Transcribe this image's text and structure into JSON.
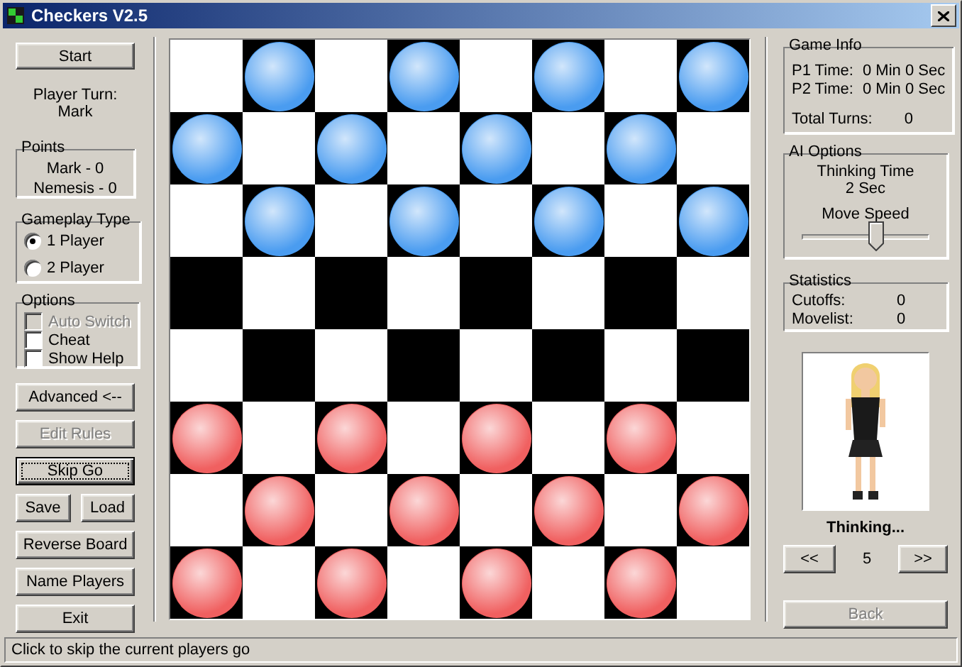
{
  "window": {
    "title": "Checkers V2.5"
  },
  "left": {
    "start_button": {
      "label": "Start",
      "disabled": false,
      "focused": false
    },
    "player_turn": {
      "label": "Player Turn:",
      "value": "Mark"
    },
    "points": {
      "title": "Points",
      "lines": [
        "Mark - 0",
        "Nemesis - 0"
      ]
    },
    "gameplay_type": {
      "title": "Gameplay Type",
      "options": [
        {
          "label": "1 Player",
          "selected": true
        },
        {
          "label": "2 Player",
          "selected": false
        }
      ]
    },
    "options": {
      "title": "Options",
      "checkboxes": [
        {
          "label": "Auto Switch",
          "checked": false,
          "disabled": true
        },
        {
          "label": "Cheat",
          "checked": false,
          "disabled": false
        },
        {
          "label": "Show Help",
          "checked": false,
          "disabled": false
        }
      ]
    },
    "button_rows": [
      [
        {
          "label": "Advanced <--",
          "disabled": false,
          "focused": false
        }
      ],
      [
        {
          "label": "Edit Rules",
          "disabled": true,
          "focused": false
        }
      ],
      [
        {
          "label": "Skip Go",
          "disabled": false,
          "focused": true
        }
      ],
      [
        {
          "label": "Save",
          "disabled": false,
          "focused": false
        },
        {
          "label": "Load",
          "disabled": false,
          "focused": false
        }
      ],
      [
        {
          "label": "Reverse Board",
          "disabled": false,
          "focused": false
        }
      ],
      [
        {
          "label": "Name Players",
          "disabled": false,
          "focused": false
        }
      ],
      [
        {
          "label": "Exit",
          "disabled": false,
          "focused": false
        }
      ]
    ]
  },
  "board": {
    "rows": [
      {
        "cells": [
          {
            "kind": "empty"
          },
          {
            "kind": "piece",
            "color": "#4a9cf0"
          },
          {
            "kind": "empty"
          },
          {
            "kind": "piece",
            "color": "#4a9cf0"
          },
          {
            "kind": "empty"
          },
          {
            "kind": "piece",
            "color": "#4a9cf0"
          },
          {
            "kind": "empty"
          },
          {
            "kind": "piece",
            "color": "#4a9cf0"
          }
        ]
      },
      {
        "cells": [
          {
            "kind": "piece",
            "color": "#4a9cf0"
          },
          {
            "kind": "empty"
          },
          {
            "kind": "piece",
            "color": "#4a9cf0"
          },
          {
            "kind": "empty"
          },
          {
            "kind": "piece",
            "color": "#4a9cf0"
          },
          {
            "kind": "empty"
          },
          {
            "kind": "piece",
            "color": "#4a9cf0"
          },
          {
            "kind": "empty"
          }
        ]
      },
      {
        "cells": [
          {
            "kind": "empty"
          },
          {
            "kind": "piece",
            "color": "#4a9cf0"
          },
          {
            "kind": "empty"
          },
          {
            "kind": "piece",
            "color": "#4a9cf0"
          },
          {
            "kind": "empty"
          },
          {
            "kind": "piece",
            "color": "#4a9cf0"
          },
          {
            "kind": "empty"
          },
          {
            "kind": "piece",
            "color": "#4a9cf0"
          }
        ]
      },
      {
        "cells": [
          {
            "kind": "empty"
          },
          {
            "kind": "empty"
          },
          {
            "kind": "empty"
          },
          {
            "kind": "empty"
          },
          {
            "kind": "empty"
          },
          {
            "kind": "empty"
          },
          {
            "kind": "empty"
          },
          {
            "kind": "empty"
          }
        ]
      },
      {
        "cells": [
          {
            "kind": "empty"
          },
          {
            "kind": "empty"
          },
          {
            "kind": "empty"
          },
          {
            "kind": "empty"
          },
          {
            "kind": "empty"
          },
          {
            "kind": "empty"
          },
          {
            "kind": "empty"
          },
          {
            "kind": "empty"
          }
        ]
      },
      {
        "cells": [
          {
            "kind": "piece",
            "color": "#f06060"
          },
          {
            "kind": "empty"
          },
          {
            "kind": "piece",
            "color": "#f06060"
          },
          {
            "kind": "empty"
          },
          {
            "kind": "piece",
            "color": "#f06060"
          },
          {
            "kind": "empty"
          },
          {
            "kind": "piece",
            "color": "#f06060"
          },
          {
            "kind": "empty"
          }
        ]
      },
      {
        "cells": [
          {
            "kind": "empty"
          },
          {
            "kind": "piece",
            "color": "#f06060"
          },
          {
            "kind": "empty"
          },
          {
            "kind": "piece",
            "color": "#f06060"
          },
          {
            "kind": "empty"
          },
          {
            "kind": "piece",
            "color": "#f06060"
          },
          {
            "kind": "empty"
          },
          {
            "kind": "piece",
            "color": "#f06060"
          }
        ]
      },
      {
        "cells": [
          {
            "kind": "piece",
            "color": "#f06060"
          },
          {
            "kind": "empty"
          },
          {
            "kind": "piece",
            "color": "#f06060"
          },
          {
            "kind": "empty"
          },
          {
            "kind": "piece",
            "color": "#f06060"
          },
          {
            "kind": "empty"
          },
          {
            "kind": "piece",
            "color": "#f06060"
          },
          {
            "kind": "empty"
          }
        ]
      }
    ]
  },
  "right": {
    "game_info": {
      "title": "Game Info",
      "rows": [
        {
          "label": "P1 Time:",
          "value": "0 Min 0 Sec"
        },
        {
          "label": "P2 Time:",
          "value": "0 Min 0 Sec"
        },
        {
          "label": "Total Turns:",
          "value": "0"
        }
      ]
    },
    "ai_options": {
      "title": "AI Options",
      "thinking_label": "Thinking Time",
      "thinking_value": "2 Sec",
      "speed_label": "Move Speed",
      "speed": {
        "level": 0.58
      }
    },
    "statistics": {
      "title": "Statistics",
      "rows": [
        {
          "label": "Cutoffs:",
          "value": "0"
        },
        {
          "label": "Movelist:",
          "value": "0"
        }
      ]
    },
    "caption": "Thinking...",
    "prev_button": {
      "label": "<<",
      "disabled": false,
      "focused": false
    },
    "count": "5",
    "next_button": {
      "label": ">>",
      "disabled": false,
      "focused": false
    },
    "back_button": {
      "label": "Back",
      "disabled": true,
      "focused": false
    }
  },
  "status_bar": "Click to skip the current players go"
}
